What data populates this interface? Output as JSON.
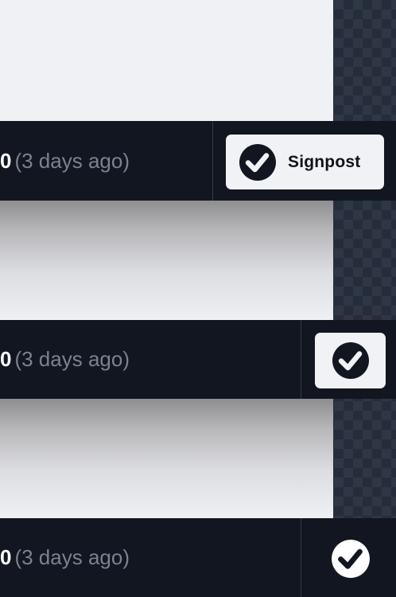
{
  "rows": [
    {
      "value": "0",
      "ago": "(3 days ago)",
      "button_label": "Signpost"
    },
    {
      "value": "0",
      "ago": "(3 days ago)"
    },
    {
      "value": "0",
      "ago": "(3 days ago)"
    }
  ],
  "icons": {
    "check": "check-circle-icon"
  },
  "colors": {
    "bar_bg": "#111620",
    "button_bg": "#f1f2f5",
    "icon_dark": "#111620",
    "icon_light": "#ffffff",
    "muted_text": "#7a8291"
  }
}
